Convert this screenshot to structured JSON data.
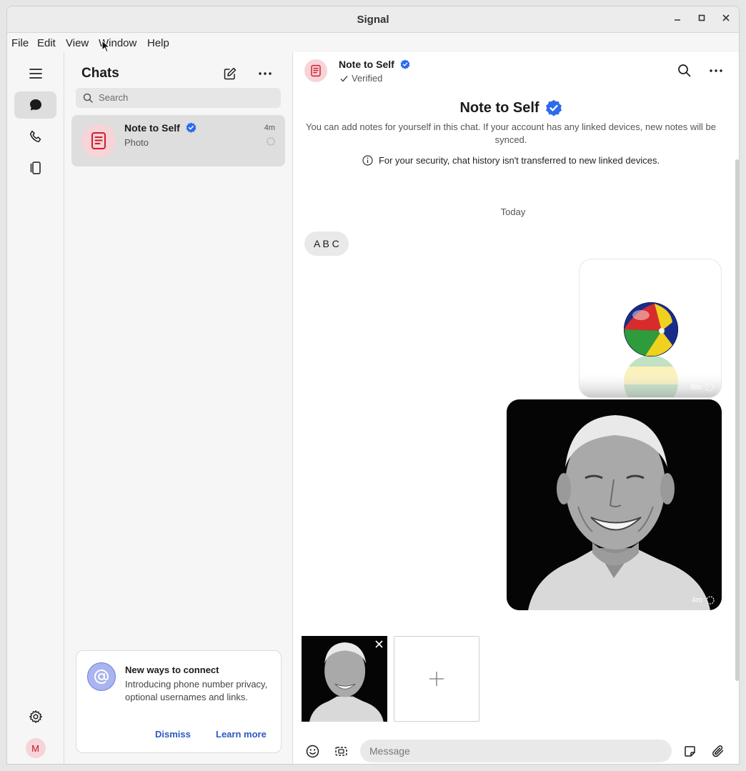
{
  "window": {
    "title": "Signal"
  },
  "menu": [
    "File",
    "Edit",
    "View",
    "Window",
    "Help"
  ],
  "sidebar": {
    "title": "Chats",
    "search_placeholder": "Search"
  },
  "chat_list": [
    {
      "name": "Note to Self",
      "preview": "Photo",
      "time": "4m"
    }
  ],
  "notice": {
    "title": "New ways to connect",
    "body": "Introducing phone number privacy, optional usernames and links.",
    "dismiss": "Dismiss",
    "learn_more": "Learn more"
  },
  "conversation": {
    "name": "Note to Self",
    "status": "Verified",
    "intro_title": "Note to Self",
    "intro_text": "You can add notes for yourself in this chat. If your account has any linked devices, new notes will be synced.",
    "security_note": "For your security, chat history isn't transferred to new linked devices.",
    "date_divider": "Today",
    "messages": [
      {
        "type": "text",
        "text": "A B C"
      },
      {
        "type": "image",
        "subject": "beach-ball",
        "time": "6m"
      },
      {
        "type": "image",
        "subject": "portrait-photo",
        "time": "4m"
      }
    ]
  },
  "composer": {
    "placeholder": "Message"
  },
  "profile": {
    "initial": "M"
  },
  "colors": {
    "accent": "#2c58c3",
    "verified": "#2c6bed",
    "note_red": "#d31c2e",
    "avatar_bg": "#f6d4d7"
  }
}
